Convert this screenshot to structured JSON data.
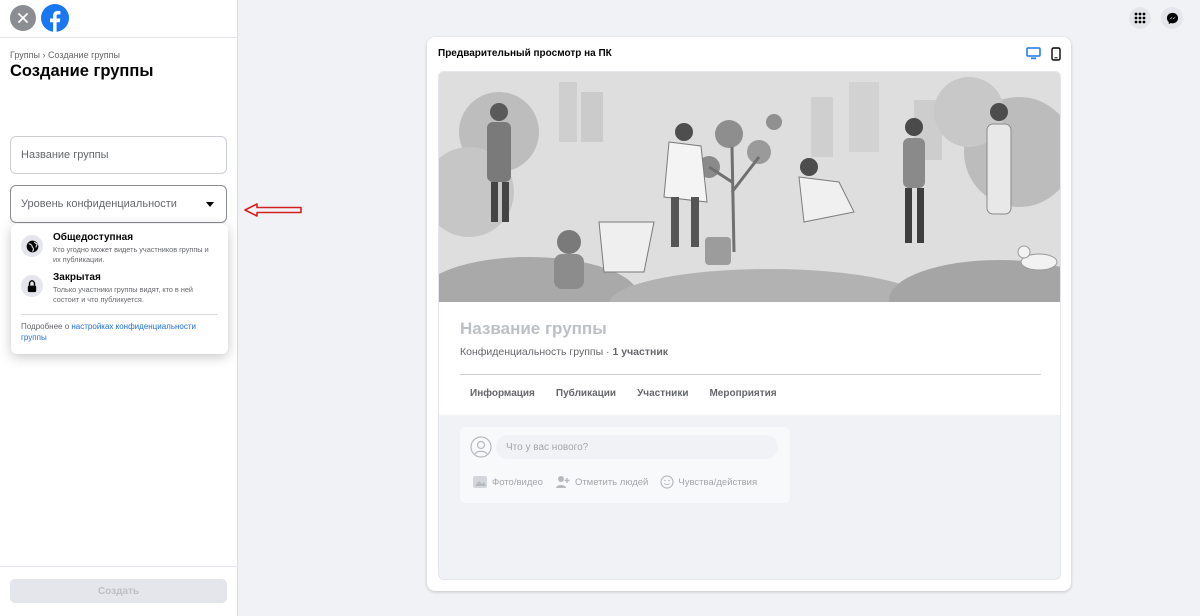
{
  "breadcrumb": "Группы › Создание группы",
  "page_title": "Создание группы",
  "form": {
    "name_placeholder": "Название группы",
    "privacy_placeholder": "Уровень конфиденциальности",
    "create_label": "Создать"
  },
  "privacy_menu": {
    "public_title": "Общедоступная",
    "public_desc": "Кто угодно может видеть участников группы и их публикации.",
    "closed_title": "Закрытая",
    "closed_desc": "Только участники группы видят, кто в ней состоит и что публикуется.",
    "footer_prefix": "Подробнее о ",
    "footer_link": "настройках конфиденциальности группы"
  },
  "preview": {
    "title": "Предварительный просмотр на ПК",
    "group_name": "Название группы",
    "privacy_text": "Конфиденциальность группы · ",
    "members_text": "1 участник",
    "tabs": [
      "Информация",
      "Публикации",
      "Участники",
      "Мероприятия"
    ],
    "composer_placeholder": "Что у вас нового?",
    "actions": [
      "Фото/видео",
      "Отметить людей",
      "Чувства/действия"
    ]
  },
  "icons": [
    "close-icon",
    "facebook-logo",
    "grid-menu-icon",
    "messenger-icon",
    "desktop-icon",
    "mobile-icon",
    "globe-icon",
    "lock-icon"
  ],
  "colors": {
    "brand": "#1877f2",
    "link": "#216fdb",
    "annotation_arrow": "#d42020"
  }
}
